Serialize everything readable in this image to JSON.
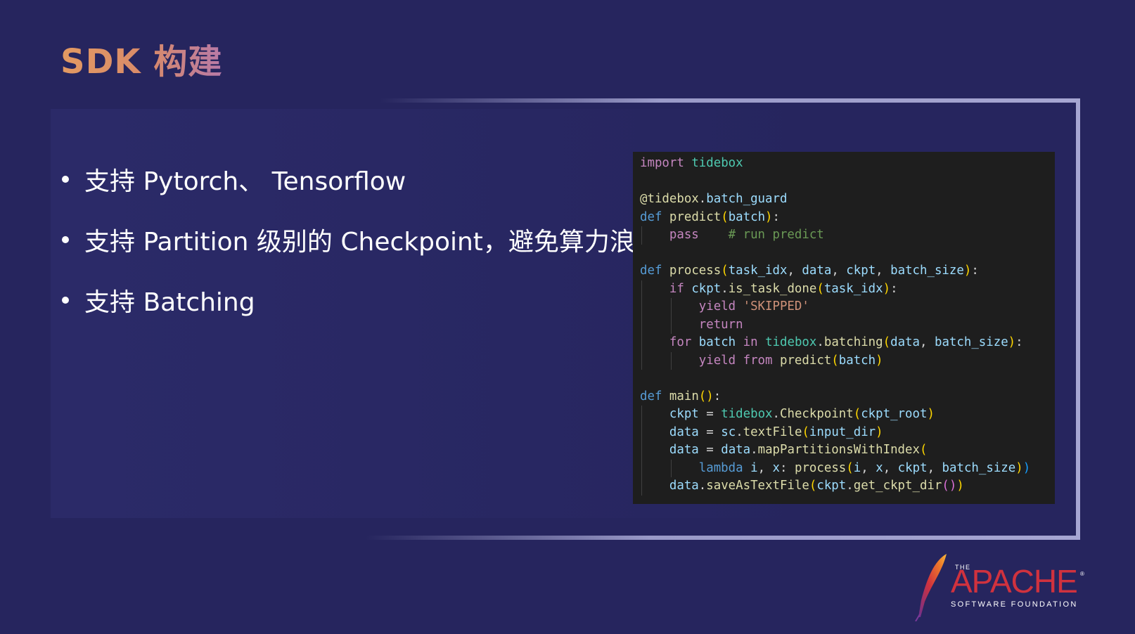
{
  "slide": {
    "title": "SDK 构建",
    "bullets": [
      "支持 Pytorch、 Tensorflow",
      "支持 Partition 级别的 Checkpoint，避免算力浪费",
      "支持 Batching"
    ]
  },
  "code": {
    "language": "python",
    "lines": [
      "import tidebox",
      "",
      "@tidebox.batch_guard",
      "def predict(batch):",
      "    pass    # run predict",
      "",
      "def process(task_idx, data, ckpt, batch_size):",
      "    if ckpt.is_task_done(task_idx):",
      "        yield 'SKIPPED'",
      "        return",
      "    for batch in tidebox.batching(data, batch_size):",
      "        yield from predict(batch)",
      "",
      "def main():",
      "    ckpt = tidebox.Checkpoint(ckpt_root)",
      "    data = sc.textFile(input_dir)",
      "    data = data.mapPartitionsWithIndex(",
      "        lambda i, x: process(i, x, ckpt, batch_size))",
      "    data.saveAsTextFile(ckpt.get_ckpt_dir())"
    ]
  },
  "logo": {
    "the": "THE",
    "name": "APACHE",
    "registered": "®",
    "subtitle": "SOFTWARE FOUNDATION",
    "icon": "feather-icon"
  },
  "colors": {
    "background": "#26255e",
    "title_gradient_start": "#e39a62",
    "title_gradient_end": "#b87aa8",
    "code_background": "#1e1e1e",
    "apache_red": "#d0323e"
  }
}
